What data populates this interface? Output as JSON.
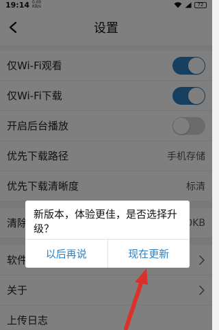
{
  "status": {
    "time": "19:14",
    "net_top": "0.00",
    "net_bottom": "KB/s",
    "battery": "72"
  },
  "header": {
    "title": "设置",
    "back_icon": "chevron-left-icon"
  },
  "settings": {
    "wifi_watch": {
      "label": "仅Wi-Fi观看",
      "enabled": true
    },
    "wifi_download": {
      "label": "仅Wi-Fi下载",
      "enabled": true
    },
    "background_play": {
      "label": "开启后台播放",
      "enabled": false
    },
    "download_path": {
      "label": "优先下载路径",
      "value": "手机存储"
    },
    "download_quality": {
      "label": "优先下载清晰度",
      "value": "标清"
    },
    "clear_cache": {
      "label": "清除",
      "value": "0KB"
    },
    "software_update": {
      "label": "软件"
    },
    "about": {
      "label": "关于"
    },
    "upload_log": {
      "label": "上传日志"
    }
  },
  "dialog": {
    "message": "新版本，体验更佳，是否选择升级？",
    "later": "以后再说",
    "update_now": "现在更新"
  },
  "colors": {
    "accent": "#2f7fc1",
    "annotation_arrow": "#d9322a"
  }
}
